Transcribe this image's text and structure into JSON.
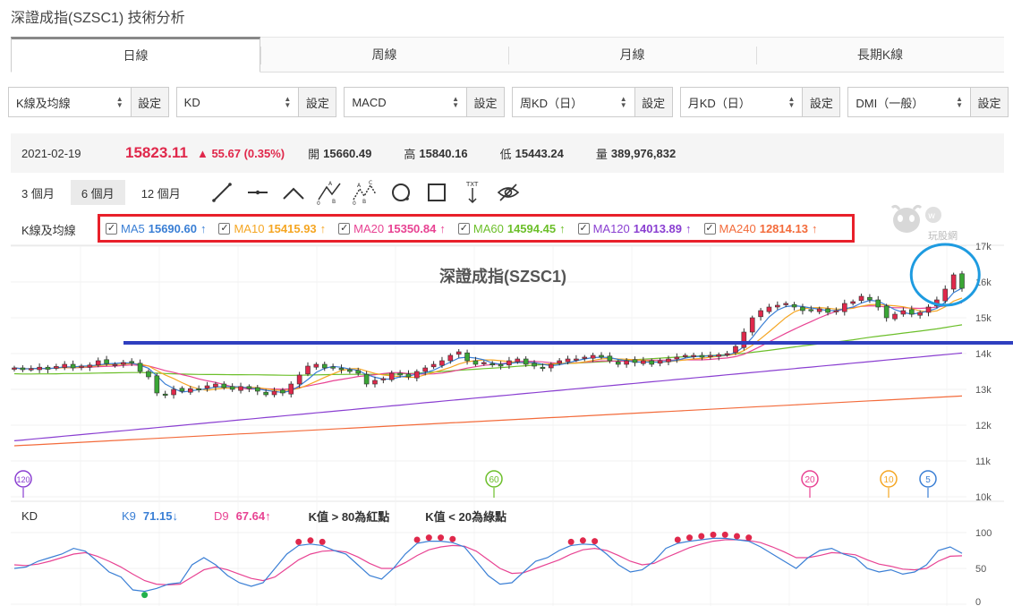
{
  "page": {
    "title": "深證成指(SZSC1) 技術分析"
  },
  "tabs": [
    {
      "label": "日線",
      "active": true
    },
    {
      "label": "周線",
      "active": false
    },
    {
      "label": "月線",
      "active": false
    },
    {
      "label": "長期K線",
      "active": false
    }
  ],
  "selects": [
    {
      "value": "K線及均線",
      "button": "設定"
    },
    {
      "value": "KD",
      "button": "設定"
    },
    {
      "value": "MACD",
      "button": "設定"
    },
    {
      "value": "周KD（日）",
      "button": "設定"
    },
    {
      "value": "月KD（日）",
      "button": "設定"
    },
    {
      "value": "DMI（一般）",
      "button": "設定"
    }
  ],
  "quote": {
    "date": "2021-02-19",
    "price": "15823.11",
    "change": "▲ 55.67 (0.35%)",
    "open_label": "開",
    "open": "15660.49",
    "high_label": "高",
    "high": "15840.16",
    "low_label": "低",
    "low": "15443.24",
    "volume_label": "量",
    "volume": "389,976,832"
  },
  "ranges": [
    {
      "label": "3 個月",
      "active": false
    },
    {
      "label": "6 個月",
      "active": true
    },
    {
      "label": "12 個月",
      "active": false
    }
  ],
  "tools": [
    "line-tool-icon",
    "horizontal-line-tool-icon",
    "angle-tool-icon",
    "abc-pattern-tool-icon",
    "abcd-pattern-tool-icon",
    "circle-tool-icon",
    "rectangle-tool-icon",
    "text-tool-icon",
    "hide-drawings-icon"
  ],
  "ma_panel": {
    "title": "K線及均線",
    "items": [
      {
        "name": "MA5",
        "value": "15690.60",
        "arrow": "↑",
        "color": "#3a7fd5"
      },
      {
        "name": "MA10",
        "value": "15415.93",
        "arrow": "↑",
        "color": "#f5a623"
      },
      {
        "name": "MA20",
        "value": "15350.84",
        "arrow": "↑",
        "color": "#e84393"
      },
      {
        "name": "MA60",
        "value": "14594.45",
        "arrow": "↑",
        "color": "#6cbf2a"
      },
      {
        "name": "MA120",
        "value": "14013.89",
        "arrow": "↑",
        "color": "#8a3fd1"
      },
      {
        "name": "MA240",
        "value": "12814.13",
        "arrow": "↑",
        "color": "#f36b3b"
      }
    ]
  },
  "logo": {
    "text": "玩股網"
  },
  "chart_data": [
    {
      "type": "candlestick",
      "title": "深證成指(SZSC1)",
      "ylim": [
        10000,
        17000
      ],
      "y_ticks": [
        "17k",
        "16k",
        "15k",
        "14k",
        "13k",
        "12k",
        "11k",
        "10k"
      ],
      "markers": [
        "120",
        "60",
        "20",
        "10",
        "5"
      ],
      "marker_colors": {
        "120": "#8a3fd1",
        "60": "#6cbf2a",
        "20": "#e84393",
        "10": "#f5a623",
        "5": "#3a7fd5"
      },
      "reference_line": {
        "value": 14300,
        "color": "#2f3fbf"
      },
      "close": [
        13600,
        13550,
        13580,
        13620,
        13560,
        13640,
        13700,
        13600,
        13650,
        13680,
        13800,
        13720,
        13700,
        13750,
        13760,
        13500,
        13350,
        12900,
        12850,
        13000,
        12950,
        13020,
        13000,
        13100,
        13150,
        13050,
        13000,
        13080,
        13020,
        12950,
        12850,
        12950,
        12900,
        13150,
        13400,
        13650,
        13700,
        13600,
        13620,
        13550,
        13500,
        13450,
        13150,
        13250,
        13300,
        13450,
        13400,
        13350,
        13500,
        13600,
        13700,
        13800,
        13950,
        14050,
        13800,
        13700,
        13750,
        13700,
        13650,
        13800,
        13850,
        13700,
        13650,
        13600,
        13700,
        13800,
        13850,
        13850,
        13900,
        13950,
        13900,
        13800,
        13700,
        13800,
        13750,
        13800,
        13700,
        13800,
        13850,
        13900,
        13950,
        13950,
        13900,
        13950,
        13970,
        14000,
        14200,
        14600,
        15000,
        15200,
        15300,
        15350,
        15400,
        15300,
        15200,
        15200,
        15250,
        15150,
        15200,
        15400,
        15450,
        15600,
        15500,
        15300,
        15000,
        15100,
        15200,
        15100,
        15150,
        15300,
        15500,
        15800,
        16200,
        15823
      ],
      "ma5_last": 15690.6,
      "ma10_last": 15415.93,
      "ma20_last": 15350.84,
      "ma60_last": 14594.45,
      "ma120_last": 14013.89,
      "ma240_last": 12814.13
    },
    {
      "type": "line",
      "title": "KD",
      "ylim": [
        0,
        100
      ],
      "y_ticks": [
        "100",
        "50",
        "0"
      ],
      "series": [
        {
          "name": "K9",
          "value": "71.15",
          "arrow": "↓",
          "color": "#3a7fd5"
        },
        {
          "name": "D9",
          "value": "67.64",
          "arrow": "↑",
          "color": "#e84393"
        }
      ],
      "notes": [
        "K值 > 80為紅點",
        "K值 < 20為綠點"
      ],
      "k": [
        50,
        52,
        60,
        65,
        70,
        78,
        74,
        60,
        45,
        38,
        20,
        18,
        22,
        28,
        30,
        55,
        65,
        55,
        40,
        30,
        25,
        30,
        50,
        70,
        82,
        84,
        82,
        75,
        70,
        55,
        40,
        35,
        50,
        70,
        85,
        88,
        88,
        86,
        80,
        60,
        40,
        28,
        30,
        45,
        60,
        65,
        75,
        82,
        84,
        83,
        70,
        55,
        45,
        48,
        60,
        78,
        85,
        88,
        90,
        92,
        92,
        90,
        88,
        80,
        70,
        60,
        50,
        65,
        75,
        78,
        70,
        65,
        50,
        45,
        48,
        42,
        45,
        55,
        75,
        80,
        71.15
      ],
      "d": [
        55,
        54,
        56,
        60,
        65,
        70,
        72,
        67,
        60,
        52,
        42,
        33,
        28,
        27,
        28,
        38,
        48,
        52,
        48,
        42,
        36,
        33,
        38,
        50,
        62,
        70,
        74,
        75,
        73,
        66,
        57,
        50,
        50,
        58,
        68,
        76,
        80,
        82,
        81,
        74,
        62,
        50,
        43,
        44,
        50,
        56,
        62,
        70,
        76,
        78,
        75,
        68,
        60,
        55,
        57,
        65,
        72,
        79,
        84,
        88,
        90,
        90,
        89,
        86,
        80,
        73,
        65,
        65,
        68,
        72,
        71,
        69,
        62,
        56,
        53,
        49,
        48,
        50,
        60,
        67,
        67.64
      ]
    }
  ]
}
